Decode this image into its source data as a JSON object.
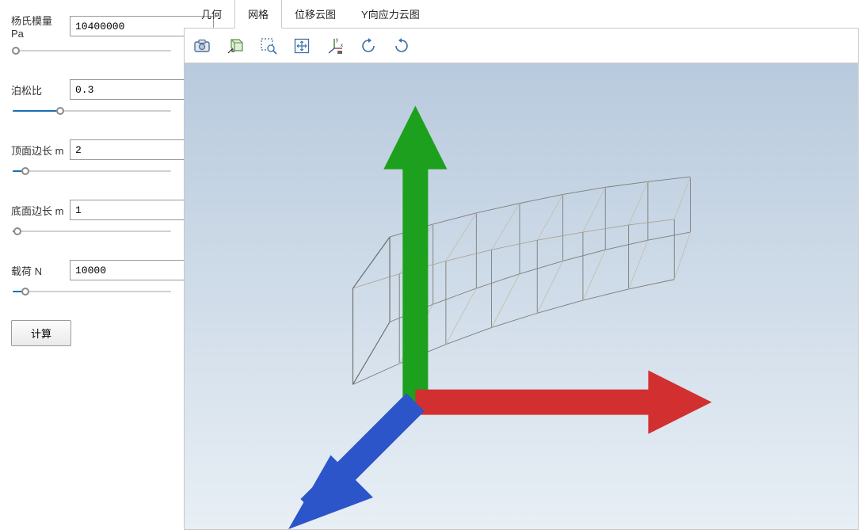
{
  "params": {
    "youngs": {
      "label": "杨氏模量 Pa",
      "value": "10400000",
      "slider_pct": 2
    },
    "poisson": {
      "label": "泊松比",
      "value": "0.3",
      "slider_pct": 30
    },
    "top_len": {
      "label": "顶面边长 m",
      "value": "2",
      "slider_pct": 8
    },
    "bot_len": {
      "label": "底面边长 m",
      "value": "1",
      "slider_pct": 3
    },
    "load": {
      "label": "载荷 N",
      "value": "10000",
      "slider_pct": 8
    }
  },
  "compute_label": "计算",
  "tabs": {
    "geometry": "几何",
    "mesh": "网格",
    "displacement": "位移云图",
    "stress_y": "Y向应力云图"
  },
  "active_tab": "mesh",
  "toolbar_icons": {
    "snapshot": "snapshot-icon",
    "cube_select": "cube-select-icon",
    "zoom_area": "zoom-area-icon",
    "fit": "fit-view-icon",
    "axes": "axes-toggle-icon",
    "rotate_left": "rotate-left-icon",
    "rotate_right": "rotate-right-icon"
  }
}
